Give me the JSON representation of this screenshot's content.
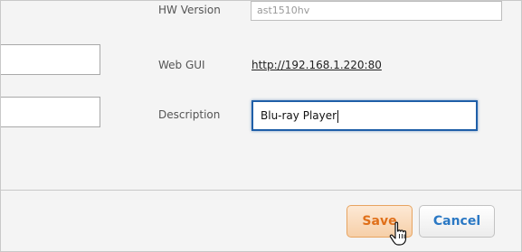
{
  "form": {
    "hw_version": {
      "label": "HW Version",
      "value": "ast1510hv"
    },
    "web_gui": {
      "label": "Web GUI",
      "url": "http://192.168.1.220:80"
    },
    "description": {
      "label": "Description",
      "value": "Blu-ray Player"
    }
  },
  "actions": {
    "save_label": "Save",
    "cancel_label": "Cancel"
  },
  "colors": {
    "save_text": "#e0701a",
    "cancel_text": "#2a78c4",
    "focus_border": "#1f5fa8"
  }
}
